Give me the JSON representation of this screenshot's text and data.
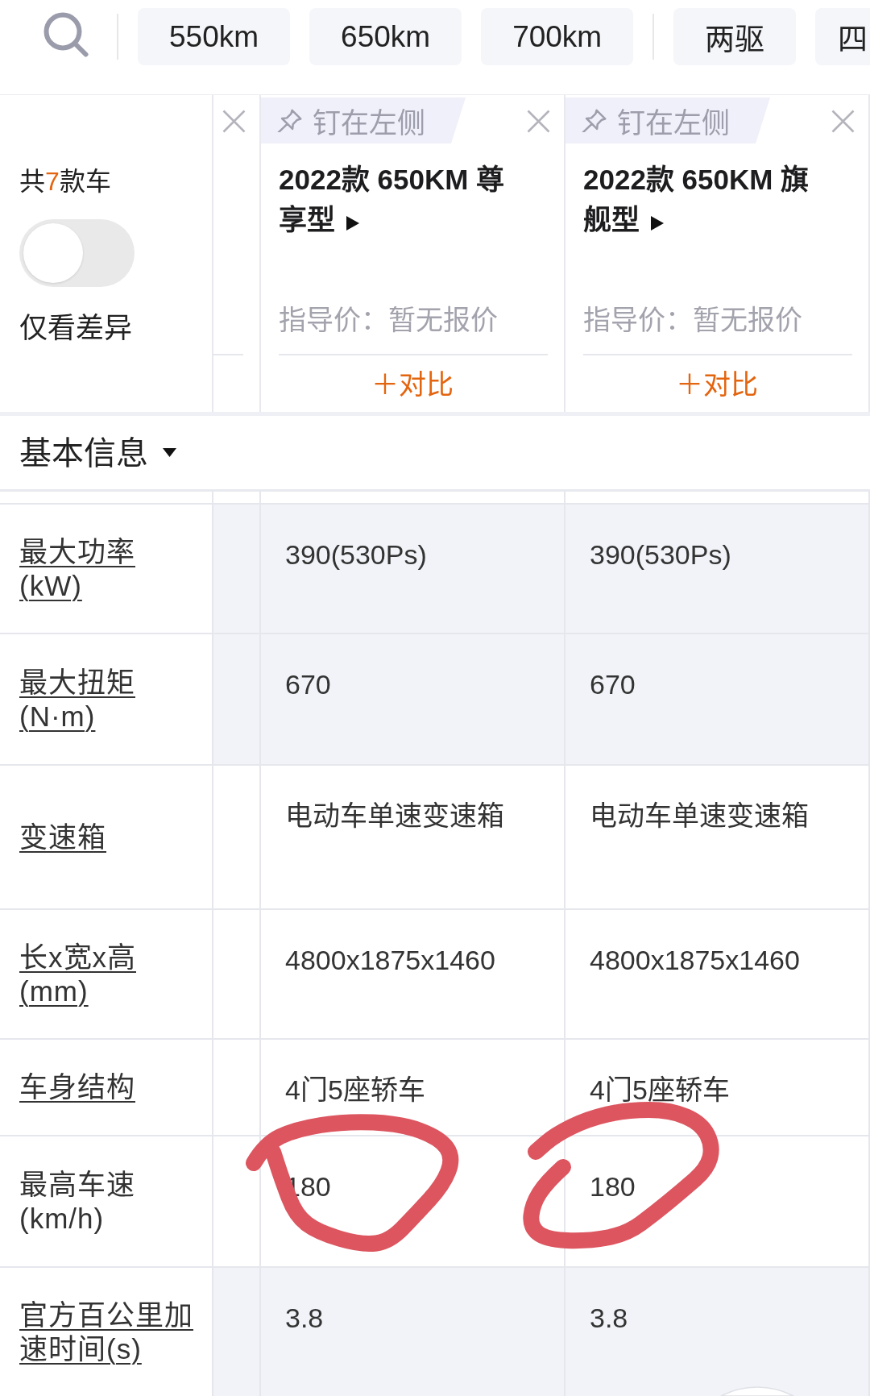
{
  "filter_bar": {
    "groups": [
      [
        {
          "label": "550km",
          "selected": false
        },
        {
          "label": "650km",
          "selected": false
        },
        {
          "label": "700km",
          "selected": false
        }
      ],
      [
        {
          "label": "两驱",
          "selected": false
        },
        {
          "label": "四",
          "selected": false
        }
      ]
    ]
  },
  "summary": {
    "count_before": "共",
    "count": "7",
    "count_after": "款车",
    "diff_toggle": {
      "label": "仅看差异",
      "on": false
    }
  },
  "cars": [
    {
      "kind": "clipped"
    },
    {
      "kind": "full",
      "pin_label": "钉在左侧",
      "title": "2022款 650KM 尊享型",
      "price": "指导价：暂无报价",
      "compare": "＋对比"
    },
    {
      "kind": "full",
      "pin_label": "钉在左侧",
      "title": "2022款 650KM 旗舰型",
      "price": "指导价：暂无报价",
      "compare": "＋对比"
    }
  ],
  "section": {
    "title": "基本信息",
    "expanded": true
  },
  "spec_rows": [
    {
      "label": "最大功率(kW)",
      "link": true,
      "highlighted": true,
      "circled": false,
      "values": [
        "390(530Ps)",
        "390(530Ps)"
      ]
    },
    {
      "label": "最大扭矩(N·m)",
      "link": true,
      "highlighted": true,
      "circled": false,
      "values": [
        "670",
        "670"
      ]
    },
    {
      "label": "变速箱",
      "link": true,
      "highlighted": false,
      "circled": false,
      "values": [
        "电动车单速变速箱",
        "电动车单速变速箱"
      ]
    },
    {
      "label": "长x宽x高(mm)",
      "link": true,
      "highlighted": false,
      "circled": false,
      "values": [
        "4800x1875x1460",
        "4800x1875x1460"
      ]
    },
    {
      "label": "车身结构",
      "link": true,
      "highlighted": false,
      "circled": false,
      "values": [
        "4门5座轿车",
        "4门5座轿车"
      ]
    },
    {
      "label": "最高车速(km/h)",
      "link": false,
      "highlighted": false,
      "circled": true,
      "values": [
        "180",
        "180"
      ]
    },
    {
      "label": "官方百公里加速时间(s)",
      "link": true,
      "highlighted": true,
      "circled": false,
      "values": [
        "3.8",
        "3.8"
      ]
    }
  ]
}
